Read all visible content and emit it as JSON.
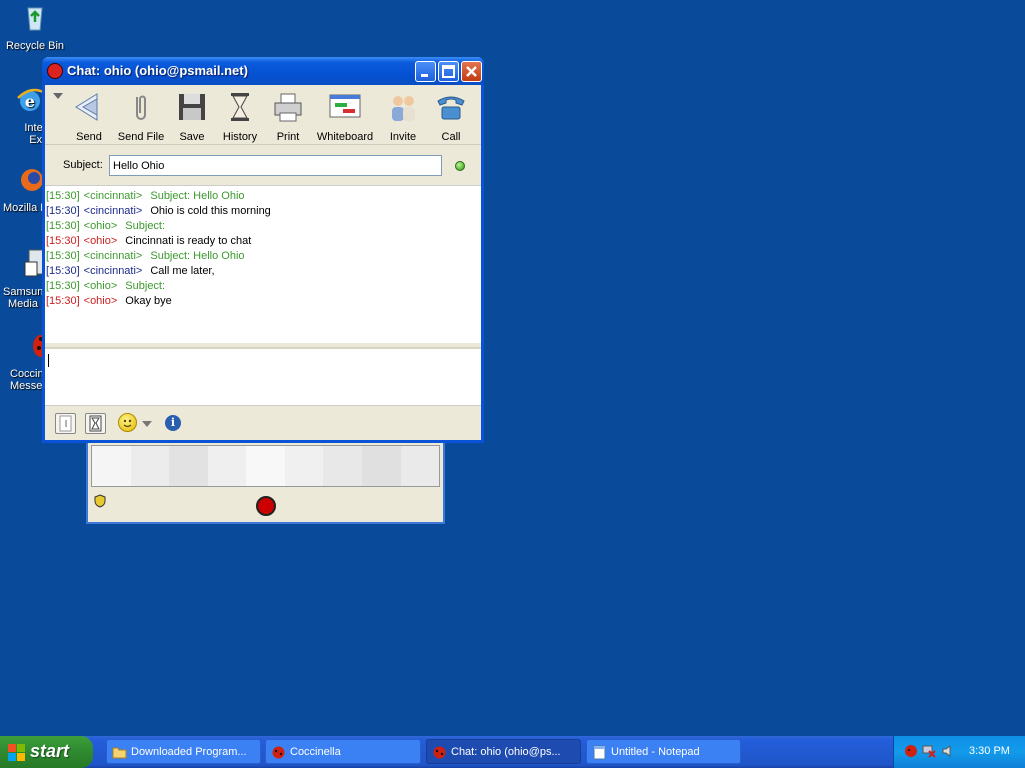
{
  "desktop": {
    "icons": [
      {
        "label": "Recycle Bin",
        "icon": "recycle-bin-icon"
      },
      {
        "label": "Internet Explo",
        "icon": "internet-explorer-icon"
      },
      {
        "label": "Mozilla F",
        "icon": "mozilla-firefox-icon"
      },
      {
        "label": "Samsung Media",
        "icon": "samsung-media-icon"
      },
      {
        "label": "Coccinella Messen",
        "icon": "coccinella-icon"
      }
    ]
  },
  "chat_window": {
    "title": "Chat: ohio (ohio@psmail.net)",
    "toolbar": [
      {
        "label": "Send",
        "icon": "send-icon"
      },
      {
        "label": "Send File",
        "icon": "paperclip-icon"
      },
      {
        "label": "Save",
        "icon": "floppy-disk-icon"
      },
      {
        "label": "History",
        "icon": "hourglass-icon"
      },
      {
        "label": "Print",
        "icon": "printer-icon"
      },
      {
        "label": "Whiteboard",
        "icon": "whiteboard-icon"
      },
      {
        "label": "Invite",
        "icon": "invite-people-icon"
      },
      {
        "label": "Call",
        "icon": "telephone-icon"
      }
    ],
    "subject_label": "Subject:",
    "subject_value": "Hello Ohio",
    "messages": [
      {
        "time": "[15:30]",
        "nick": "<cincinnati>",
        "text": "Subject: Hello Ohio",
        "kind": "subject"
      },
      {
        "time": "[15:30]",
        "nick": "<cincinnati>",
        "text": "Ohio is cold this morning",
        "kind": "me"
      },
      {
        "time": "[15:30]",
        "nick": "<ohio>",
        "text": "Subject:",
        "kind": "subject"
      },
      {
        "time": "[15:30]",
        "nick": "<ohio>",
        "text": "Cincinnati is ready to chat",
        "kind": "other"
      },
      {
        "time": "[15:30]",
        "nick": "<cincinnati>",
        "text": "Subject: Hello Ohio",
        "kind": "subject"
      },
      {
        "time": "[15:30]",
        "nick": "<cincinnati>",
        "text": "Call me later,",
        "kind": "me"
      },
      {
        "time": "[15:30]",
        "nick": "<ohio>",
        "text": "Subject:",
        "kind": "subject"
      },
      {
        "time": "[15:30]",
        "nick": "<ohio>",
        "text": "Okay bye",
        "kind": "other"
      }
    ],
    "compose_value": ""
  },
  "taskbar": {
    "start_label": "start",
    "tasks": [
      {
        "label": "Downloaded Program...",
        "icon": "folder-icon",
        "active": false
      },
      {
        "label": "Coccinella",
        "icon": "coccinella-icon",
        "active": false
      },
      {
        "label": "Chat: ohio (ohio@ps...",
        "icon": "coccinella-icon",
        "active": true
      },
      {
        "label": "Untitled - Notepad",
        "icon": "notepad-icon",
        "active": false
      }
    ],
    "clock": "3:30 PM"
  },
  "colors": {
    "desktop": "#0a4a9a",
    "subject_text": "#3c9a2e",
    "self_nick": "#1c2a8a",
    "other_nick": "#cc2020"
  }
}
